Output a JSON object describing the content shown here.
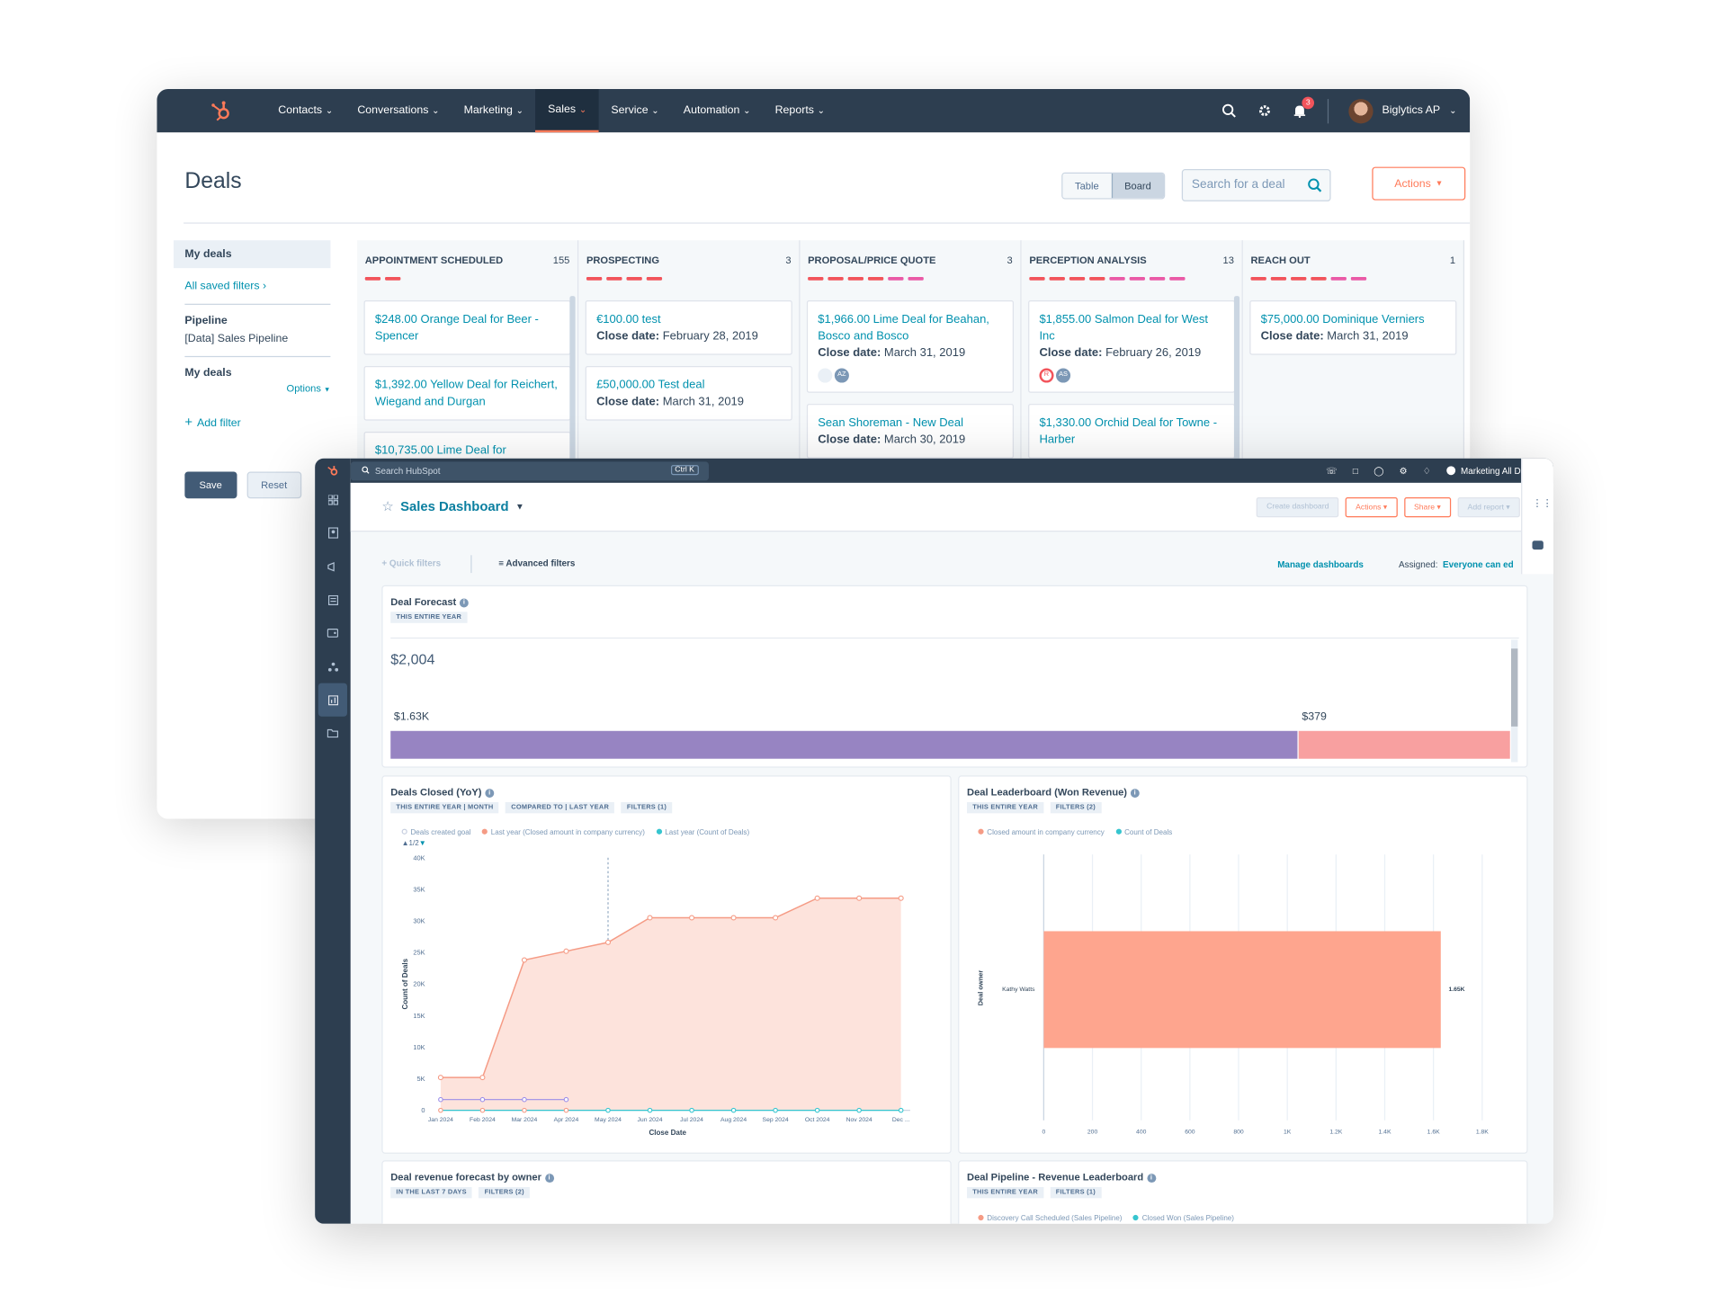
{
  "back": {
    "nav": {
      "items": [
        {
          "label": "Contacts"
        },
        {
          "label": "Conversations"
        },
        {
          "label": "Marketing"
        },
        {
          "label": "Sales",
          "active": true
        },
        {
          "label": "Service"
        },
        {
          "label": "Automation"
        },
        {
          "label": "Reports"
        }
      ],
      "notification_count": "3",
      "account": "Biglytics AP"
    },
    "title": "Deals",
    "view_toggle": {
      "table": "Table",
      "board": "Board"
    },
    "search_placeholder": "Search for a deal",
    "actions": "Actions",
    "sidebar": {
      "my_deals": "My deals",
      "all_saved_filters": "All saved filters",
      "pipeline_label": "Pipeline",
      "pipeline_value": "[Data] Sales Pipeline",
      "my_deals_label": "My deals",
      "options": "Options",
      "add_filter": "Add filter",
      "save": "Save",
      "reset": "Reset"
    },
    "columns": [
      {
        "name": "APPOINTMENT SCHEDULED",
        "count": "155",
        "cards": [
          {
            "title": "$248.00 Orange Deal for Beer - Spencer"
          },
          {
            "title": "$1,392.00 Yellow Deal for Reichert, Wiegand and Durgan"
          },
          {
            "title": "$10,735.00 Lime Deal for"
          }
        ]
      },
      {
        "name": "PROSPECTING",
        "count": "3",
        "cards": [
          {
            "title": "€100.00 test",
            "close_label": "Close date:",
            "close": "February 28, 2019"
          },
          {
            "title": "£50,000.00 Test deal",
            "close_label": "Close date:",
            "close": "March 31, 2019"
          }
        ]
      },
      {
        "name": "PROPOSAL/PRICE QUOTE",
        "count": "3",
        "cards": [
          {
            "title": "$1,966.00 Lime Deal for Beahan, Bosco and Bosco",
            "close_label": "Close date:",
            "close": "March 31, 2019",
            "avatar": "AZ"
          },
          {
            "title": "Sean Shoreman - New Deal",
            "close_label": "Close date:",
            "close": "March 30, 2019"
          }
        ]
      },
      {
        "name": "PERCEPTION ANALYSIS",
        "count": "13",
        "cards": [
          {
            "title": "$1,855.00 Salmon Deal for West Inc",
            "close_label": "Close date:",
            "close": "February 26, 2019",
            "avatar": "AS"
          },
          {
            "title": "$1,330.00 Orchid Deal for Towne - Harber"
          }
        ]
      },
      {
        "name": "REACH OUT",
        "count": "1",
        "cards": [
          {
            "title": "$75,000.00 Dominique Verniers",
            "close_label": "Close date:",
            "close": "March 31, 2019"
          }
        ]
      }
    ]
  },
  "front": {
    "search": "Search HubSpot",
    "shortcut": "Ctrl K",
    "account": "Marketing All Day",
    "title": "Sales Dashboard",
    "buttons": {
      "create": "Create dashboard",
      "actions": "Actions",
      "share": "Share",
      "add": "Add report"
    },
    "filters": {
      "quick": "Quick filters",
      "advanced": "Advanced filters",
      "manage": "Manage dashboards",
      "assigned_label": "Assigned:",
      "assigned_value": "Everyone can ed"
    },
    "forecast": {
      "title": "Deal Forecast",
      "tag": "THIS ENTIRE YEAR",
      "total": "$2,004",
      "left_label": "$1.63K",
      "right_label": "$379",
      "segments": [
        1625,
        379
      ],
      "colors": [
        "#9784c2",
        "#f8a0a0"
      ]
    },
    "closed": {
      "title": "Deals Closed (YoY)",
      "tags": [
        "THIS ENTIRE YEAR | MONTH",
        "COMPARED TO | LAST YEAR",
        "FILTERS (1)"
      ],
      "legend": [
        "Deals created goal",
        "Last year (Closed amount in company currency)",
        "Last year (Count of Deals)"
      ],
      "pager": "1/2"
    },
    "leaderboard": {
      "title": "Deal Leaderboard (Won Revenue)",
      "tags": [
        "THIS ENTIRE YEAR",
        "FILTERS (2)"
      ],
      "legend": [
        "Closed amount in company currency",
        "Count of Deals"
      ]
    },
    "rev_owner": {
      "title": "Deal revenue forecast by owner",
      "tags": [
        "IN THE LAST 7 DAYS",
        "FILTERS (2)"
      ]
    },
    "pipeline_rev": {
      "title": "Deal Pipeline - Revenue Leaderboard",
      "tags": [
        "THIS ENTIRE YEAR",
        "FILTERS (1)"
      ],
      "legend": [
        "Discovery Call Scheduled (Sales Pipeline)",
        "Closed Won (Sales Pipeline)"
      ]
    }
  },
  "chart_data": [
    {
      "type": "area",
      "title": "Deals Closed (YoY)",
      "xlabel": "Close Date",
      "ylabel": "Count of Deals",
      "ylim": [
        0,
        40000
      ],
      "yticks": [
        "0",
        "5K",
        "10K",
        "15K",
        "20K",
        "25K",
        "30K",
        "35K",
        "40K"
      ],
      "categories": [
        "Jan 2024",
        "Feb 2024",
        "Mar 2024",
        "Apr 2024",
        "May 2024",
        "Jun 2024",
        "Jul 2024",
        "Aug 2024",
        "Sep 2024",
        "Oct 2024",
        "Nov 2024",
        "Dec ..."
      ],
      "series": [
        {
          "name": "Last year (Closed amount in company currency)",
          "color": "#f59b85",
          "values": [
            5200,
            5200,
            23800,
            25200,
            26600,
            30500,
            30500,
            30500,
            30500,
            33600,
            33600,
            33600
          ]
        },
        {
          "name": "Deals created goal",
          "color": "#9c8ee8",
          "values": [
            1700,
            1700,
            1700,
            1700,
            null,
            null,
            null,
            null,
            null,
            null,
            null,
            null
          ]
        },
        {
          "name": "Last year (Count of Deals)",
          "color": "#36c5cf",
          "values": [
            0,
            0,
            0,
            0,
            0,
            0,
            0,
            0,
            0,
            0,
            0,
            0
          ]
        }
      ],
      "legend": "top"
    },
    {
      "type": "bar",
      "title": "Deal Leaderboard (Won Revenue)",
      "orientation": "horizontal",
      "ylabel": "Deal owner",
      "categories": [
        "Kathy Watts"
      ],
      "values": [
        1630
      ],
      "value_label": "1.65K",
      "xlim": [
        0,
        1800
      ],
      "xticks": [
        "0",
        "200",
        "400",
        "600",
        "800",
        "1K",
        "1.2K",
        "1.4K",
        "1.6K",
        "1.8K"
      ],
      "color": "#fea58e"
    }
  ]
}
